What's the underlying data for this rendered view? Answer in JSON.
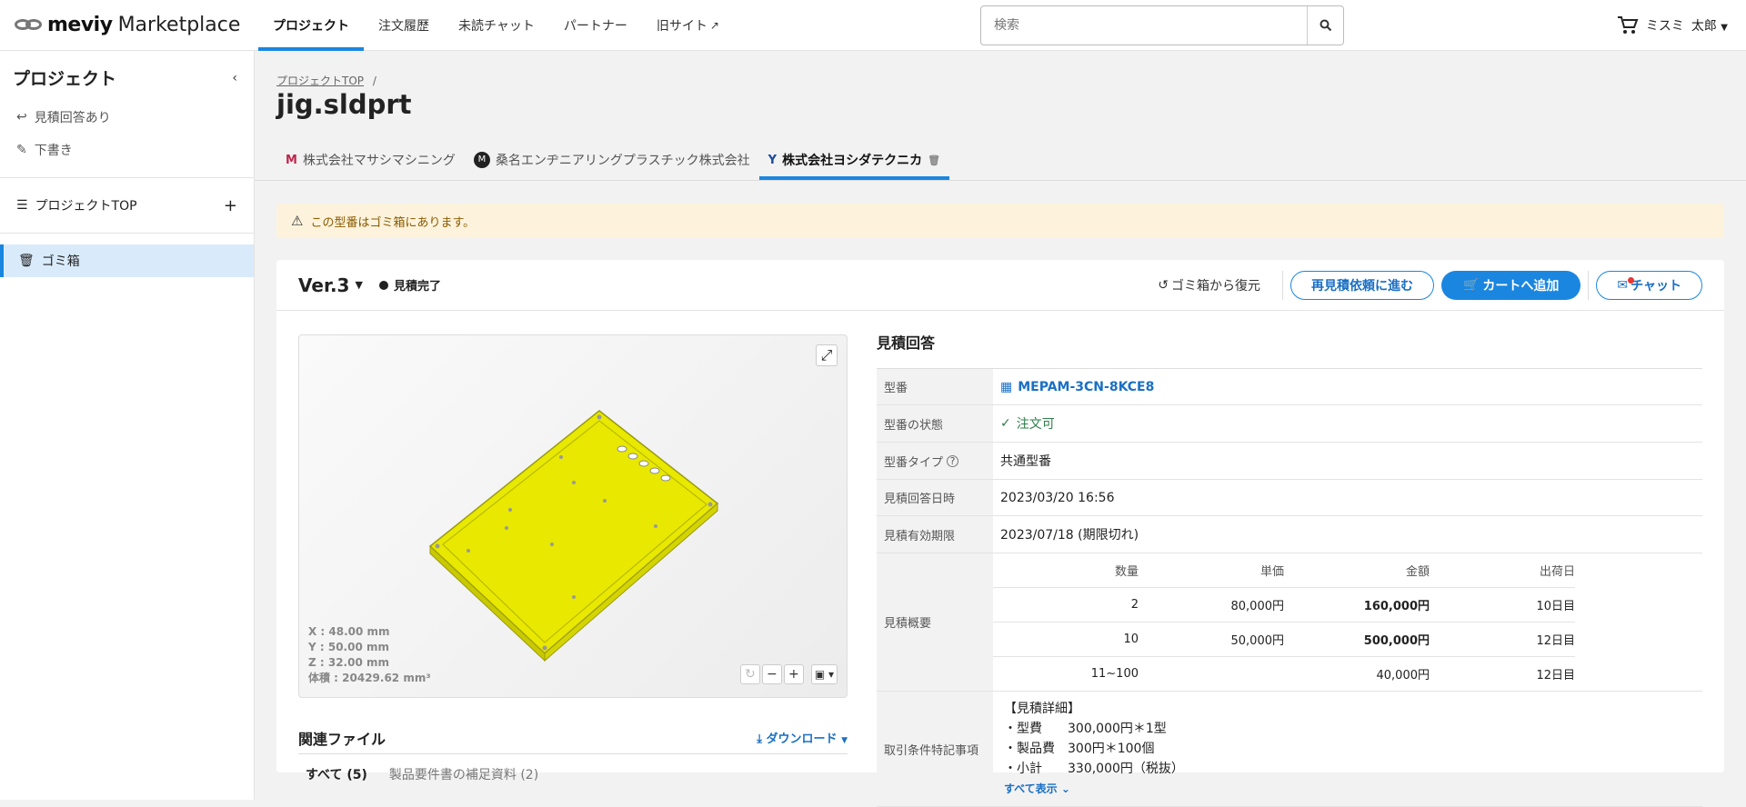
{
  "app": {
    "brand": "meviy",
    "product": "Marketplace"
  },
  "nav": [
    {
      "label": "プロジェクト",
      "active": true
    },
    {
      "label": "注文履歴"
    },
    {
      "label": "未読チャット"
    },
    {
      "label": "パートナー"
    },
    {
      "label": "旧サイト"
    }
  ],
  "search": {
    "placeholder": "検索"
  },
  "user": {
    "company": "ミスミ",
    "name": "太郎"
  },
  "sidebar": {
    "title": "プロジェクト",
    "items": [
      {
        "label": "見積回答あり"
      },
      {
        "label": "下書き"
      }
    ],
    "project_top": "プロジェクトTOP",
    "trash": "ゴミ箱"
  },
  "breadcrumb": {
    "root": "プロジェクトTOP",
    "sep": "/"
  },
  "page": {
    "title": "jig.sldprt"
  },
  "tabs": [
    {
      "label": "株式会社マサシマシニング"
    },
    {
      "label": "桑名エンヂニアリングプラスチック株式会社"
    },
    {
      "label": "株式会社ヨシダテクニカ",
      "active": true
    }
  ],
  "warning": {
    "text": "この型番はゴミ箱にあります。"
  },
  "card": {
    "version": "Ver.3",
    "status": "見積完了",
    "restore": "ゴミ箱から復元",
    "requote": "再見積依頼に進む",
    "cart": "カートへ追加",
    "chat": "チャット"
  },
  "viewer": {
    "x": "X : 48.00 mm",
    "y": "Y : 50.00 mm",
    "z": "Z : 32.00 mm",
    "volume": "体積 : 20429.62 mm³",
    "part_color": "#e8e800"
  },
  "related": {
    "title": "関連ファイル",
    "download": "ダウンロード",
    "tabs": [
      "すべて (5)",
      "製品要件書の補足資料 (2)"
    ]
  },
  "quote": {
    "title": "見積回答",
    "part_no_label": "型番",
    "part_no": "MEPAM-3CN-8KCE8",
    "state_label": "型番の状態",
    "state": "注文可",
    "type_label": "型番タイプ",
    "type": "共通型番",
    "answered_label": "見積回答日時",
    "answered": "2023/03/20 16:56",
    "expiry_label": "見積有効期限",
    "expiry": "2023/07/18 (期限切れ)",
    "summary_label": "見積概要",
    "summary_headers": [
      "数量",
      "単価",
      "金額",
      "出荷日"
    ],
    "summary_rows": [
      [
        "2",
        "80,000円",
        "160,000円",
        "10日目"
      ],
      [
        "10",
        "50,000円",
        "500,000円",
        "12日目"
      ],
      [
        "11~100",
        "",
        "40,000円",
        "12日目"
      ]
    ],
    "notes_label": "取引条件特記事項",
    "notes": [
      "【見積詳細】",
      "・型費　　300,000円＊1型",
      "・製品費　300円＊100個",
      "・小計　　330,000円（税抜）"
    ],
    "show_all": "すべて表示"
  }
}
